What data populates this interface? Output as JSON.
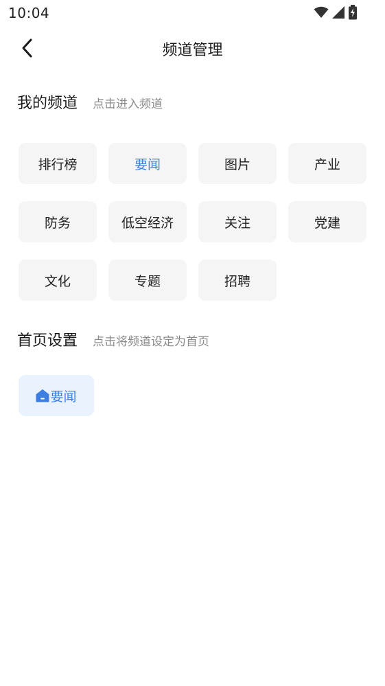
{
  "status_bar": {
    "time": "10:04",
    "icons": [
      "wifi-icon",
      "cellular-signal-icon",
      "battery-charging-icon"
    ]
  },
  "nav": {
    "title": "频道管理",
    "back_icon": "chevron-left-icon"
  },
  "my_channels": {
    "title": "我的频道",
    "hint": "点击进入频道",
    "items": [
      {
        "label": "排行榜",
        "active": false
      },
      {
        "label": "要闻",
        "active": true
      },
      {
        "label": "图片",
        "active": false
      },
      {
        "label": "产业",
        "active": false
      },
      {
        "label": "防务",
        "active": false
      },
      {
        "label": "低空经济",
        "active": false
      },
      {
        "label": "关注",
        "active": false
      },
      {
        "label": "党建",
        "active": false
      },
      {
        "label": "文化",
        "active": false
      },
      {
        "label": "专题",
        "active": false
      },
      {
        "label": "招聘",
        "active": false
      }
    ]
  },
  "home_settings": {
    "title": "首页设置",
    "hint": "点击将频道设定为首页",
    "current": {
      "label": "要闻",
      "icon": "home-icon"
    }
  },
  "colors": {
    "accent": "#3d7fe0",
    "chip_bg": "#f5f5f5",
    "home_chip_bg": "#eaf2fd",
    "hint_text": "#8a8a8a"
  }
}
